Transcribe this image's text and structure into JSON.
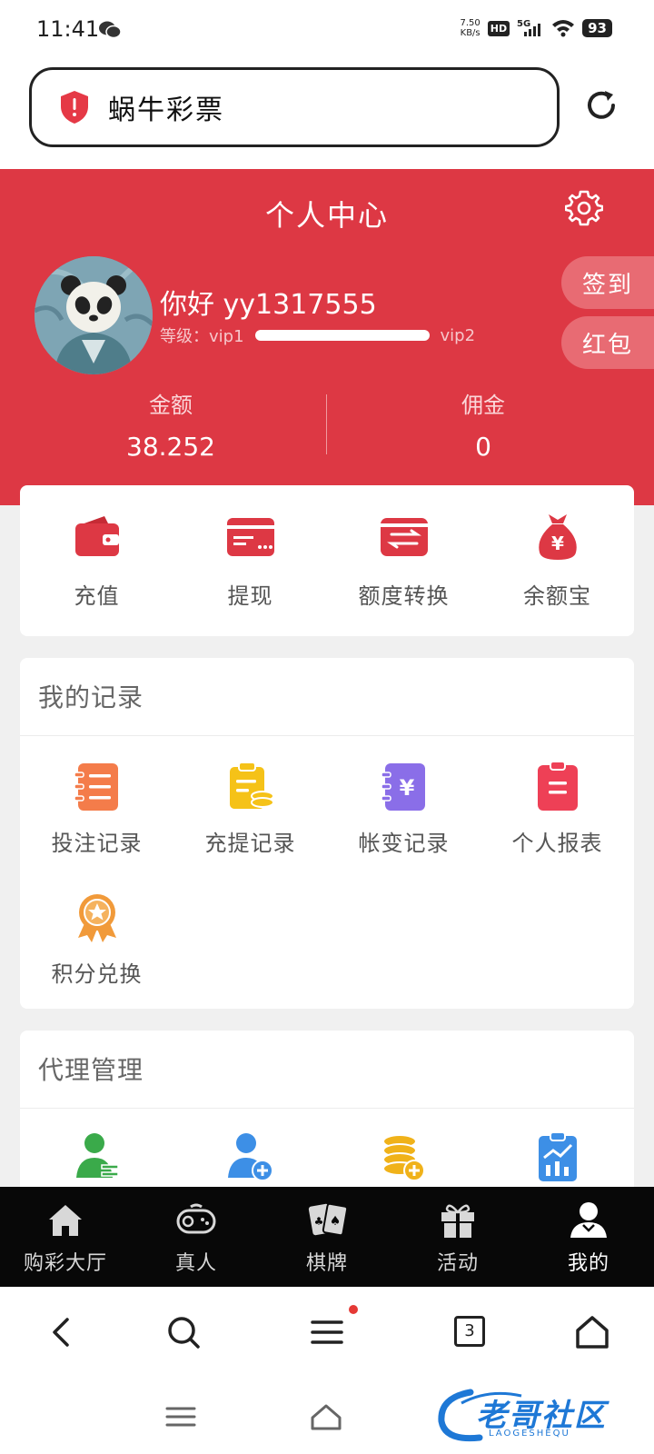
{
  "status_bar": {
    "time": "11:41",
    "net_speed_value": "7.50",
    "net_speed_unit": "KB/s",
    "hd": "HD",
    "signal": "5G",
    "battery": "93"
  },
  "browser": {
    "url_title": "蜗牛彩票",
    "tab_count": "3"
  },
  "header": {
    "title": "个人中心",
    "greeting": "你好 yy1317555",
    "level_label": "等级：vip1",
    "level_next": "vip2",
    "level_progress": 1.0,
    "sign_in": "签到",
    "red_packet": "红包",
    "balance_label": "金额",
    "balance_value": "38.252",
    "commission_label": "佣金",
    "commission_value": "0"
  },
  "quick_actions": [
    {
      "label": "充值",
      "icon": "wallet-icon"
    },
    {
      "label": "提现",
      "icon": "card-icon"
    },
    {
      "label": "额度转换",
      "icon": "transfer-icon"
    },
    {
      "label": "余额宝",
      "icon": "money-bag-icon"
    }
  ],
  "records": {
    "title": "我的记录",
    "items": [
      {
        "label": "投注记录",
        "icon": "bet-record-icon",
        "color": "#f47c4a"
      },
      {
        "label": "充提记录",
        "icon": "deposit-record-icon",
        "color": "#f5c218"
      },
      {
        "label": "帐变记录",
        "icon": "account-change-icon",
        "color": "#8a6ee8"
      },
      {
        "label": "个人报表",
        "icon": "report-icon",
        "color": "#ee4056"
      },
      {
        "label": "积分兑换",
        "icon": "medal-icon",
        "color": "#f19a3a"
      }
    ]
  },
  "agent": {
    "title": "代理管理"
  },
  "tabbar": [
    {
      "label": "购彩大厅",
      "icon": "home-icon"
    },
    {
      "label": "真人",
      "icon": "gamepad-icon"
    },
    {
      "label": "棋牌",
      "icon": "cards-icon"
    },
    {
      "label": "活动",
      "icon": "gift-icon"
    },
    {
      "label": "我的",
      "icon": "user-icon",
      "active": true
    }
  ],
  "watermark": {
    "text": "老哥社区",
    "sub": "LAOGESHEQU"
  },
  "colors": {
    "brand_red": "#dd3844",
    "tabbar_bg": "#080808"
  }
}
